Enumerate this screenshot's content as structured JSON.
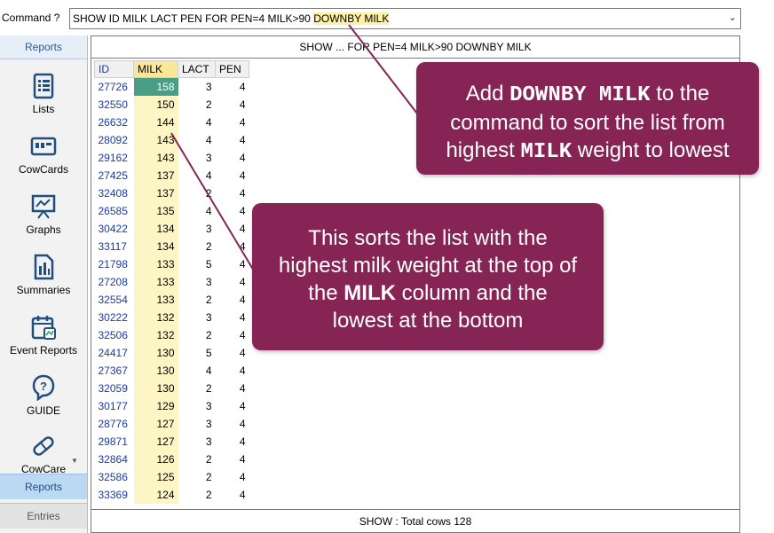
{
  "command": {
    "label": "Command ?",
    "text_main": "SHOW ID MILK LACT PEN FOR PEN=4 MILK>90 ",
    "text_highlight": "DOWNBY MILK"
  },
  "sidebar": {
    "header": "Reports",
    "items": [
      {
        "label": "Lists",
        "icon": "lists-icon"
      },
      {
        "label": "CowCards",
        "icon": "cowcards-icon"
      },
      {
        "label": "Graphs",
        "icon": "graphs-icon"
      },
      {
        "label": "Summaries",
        "icon": "summaries-icon"
      },
      {
        "label": "Event Reports",
        "icon": "event-reports-icon"
      },
      {
        "label": "GUIDE",
        "icon": "guide-icon"
      },
      {
        "label": "CowCare",
        "icon": "cowcare-icon"
      }
    ],
    "reports_button": "Reports",
    "entries_button": "Entries"
  },
  "panel": {
    "title": "SHOW ...  FOR PEN=4 MILK>90 DOWNBY MILK",
    "footer": "SHOW : Total cows  128"
  },
  "table": {
    "headers": [
      "ID",
      "MILK",
      "LACT",
      "PEN"
    ],
    "rows": [
      [
        "27726",
        "158",
        "3",
        "4"
      ],
      [
        "32550",
        "150",
        "2",
        "4"
      ],
      [
        "26632",
        "144",
        "4",
        "4"
      ],
      [
        "28092",
        "143",
        "4",
        "4"
      ],
      [
        "29162",
        "143",
        "3",
        "4"
      ],
      [
        "27425",
        "137",
        "4",
        "4"
      ],
      [
        "32408",
        "137",
        "2",
        "4"
      ],
      [
        "26585",
        "135",
        "4",
        "4"
      ],
      [
        "30422",
        "134",
        "3",
        "4"
      ],
      [
        "33117",
        "134",
        "2",
        "4"
      ],
      [
        "21798",
        "133",
        "5",
        "4"
      ],
      [
        "27208",
        "133",
        "3",
        "4"
      ],
      [
        "32554",
        "133",
        "2",
        "4"
      ],
      [
        "30222",
        "132",
        "3",
        "4"
      ],
      [
        "32506",
        "132",
        "2",
        "4"
      ],
      [
        "24417",
        "130",
        "5",
        "4"
      ],
      [
        "27367",
        "130",
        "4",
        "4"
      ],
      [
        "32059",
        "130",
        "2",
        "4"
      ],
      [
        "30177",
        "129",
        "3",
        "4"
      ],
      [
        "28776",
        "127",
        "3",
        "4"
      ],
      [
        "29871",
        "127",
        "3",
        "4"
      ],
      [
        "32864",
        "126",
        "2",
        "4"
      ],
      [
        "32586",
        "125",
        "2",
        "4"
      ],
      [
        "33369",
        "124",
        "2",
        "4"
      ]
    ]
  },
  "callouts": {
    "first": {
      "line1_a": "Add ",
      "line1_code": "DOWNBY MILK",
      "line1_b": "  to the",
      "line2": "command to sort the list from",
      "line3_a": "highest ",
      "line3_code": "MILK",
      "line3_b": " weight to lowest"
    },
    "second": {
      "line1": "This sorts the list with the",
      "line2": "highest milk weight at the top of",
      "line3_a": "the ",
      "line3_bold": "MILK",
      "line3_b": " column and the",
      "line4": "lowest at the bottom"
    }
  },
  "colors": {
    "callout": "#862455",
    "milk_column": "#fdf5c4",
    "selected_cell": "#4a9e86",
    "id_text": "#1a3aa8"
  }
}
